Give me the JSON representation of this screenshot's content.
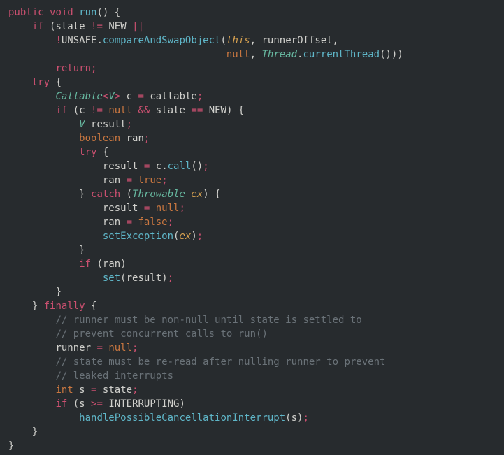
{
  "tokens": {
    "public": "public",
    "void": "void",
    "run": "run",
    "if": "if",
    "state": "state",
    "NEW": "NEW",
    "UNSAFE": "UNSAFE",
    "compareAndSwapObject": "compareAndSwapObject",
    "this": "this",
    "runnerOffset": "runnerOffset",
    "null": "null",
    "Thread": "Thread",
    "currentThread": "currentThread",
    "return": "return",
    "try": "try",
    "Callable": "Callable",
    "V": "V",
    "c": "c",
    "callable": "callable",
    "result": "result",
    "boolean": "boolean",
    "ran": "ran",
    "call": "call",
    "true": "true",
    "catch": "catch",
    "Throwable": "Throwable",
    "ex": "ex",
    "false": "false",
    "setException": "setException",
    "set": "set",
    "finally": "finally",
    "cmt1": "// runner must be non-null until state is settled to",
    "cmt2": "// prevent concurrent calls to run()",
    "runner": "runner",
    "cmt3": "// state must be re-read after nulling runner to prevent",
    "cmt4": "// leaked interrupts",
    "int": "int",
    "s": "s",
    "INTERRUPTING": "INTERRUPTING",
    "handlePossibleCancellationInterrupt": "handlePossibleCancellationInterrupt"
  }
}
